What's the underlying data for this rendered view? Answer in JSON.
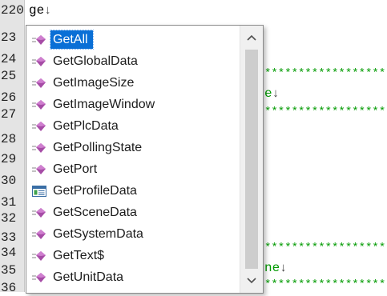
{
  "editor": {
    "line_numbers": [
      "220",
      "23",
      "24",
      "25",
      "26",
      "27",
      "28",
      "29",
      "30",
      "31",
      "32",
      "33",
      "34",
      "35",
      "36"
    ],
    "current_line_text": "ge",
    "fragments": {
      "stars_1": "******************",
      "char_e_1": "e",
      "stars_2": "******************",
      "stars_3": "******************",
      "char_ne": "ne",
      "stars_4": "******************"
    },
    "return_glyph": "↓"
  },
  "autocomplete": {
    "selected_index": 0,
    "items": [
      {
        "label": "GetAll",
        "icon": "method-icon"
      },
      {
        "label": "GetGlobalData",
        "icon": "method-icon"
      },
      {
        "label": "GetImageSize",
        "icon": "method-icon"
      },
      {
        "label": "GetImageWindow",
        "icon": "method-icon"
      },
      {
        "label": "GetPlcData",
        "icon": "method-icon"
      },
      {
        "label": "GetPollingState",
        "icon": "method-icon"
      },
      {
        "label": "GetPort",
        "icon": "method-icon"
      },
      {
        "label": "GetProfileData",
        "icon": "class-icon"
      },
      {
        "label": "GetSceneData",
        "icon": "method-icon"
      },
      {
        "label": "GetSystemData",
        "icon": "method-icon"
      },
      {
        "label": "GetText$",
        "icon": "method-icon"
      },
      {
        "label": "GetUnitData",
        "icon": "method-icon"
      }
    ],
    "scrollbar": {
      "up_icon": "chevron-up-icon",
      "down_icon": "chevron-down-icon"
    }
  },
  "colors": {
    "selection": "#0a6fd6",
    "comment_green": "#009a00",
    "method_icon": "#a64ca6"
  }
}
